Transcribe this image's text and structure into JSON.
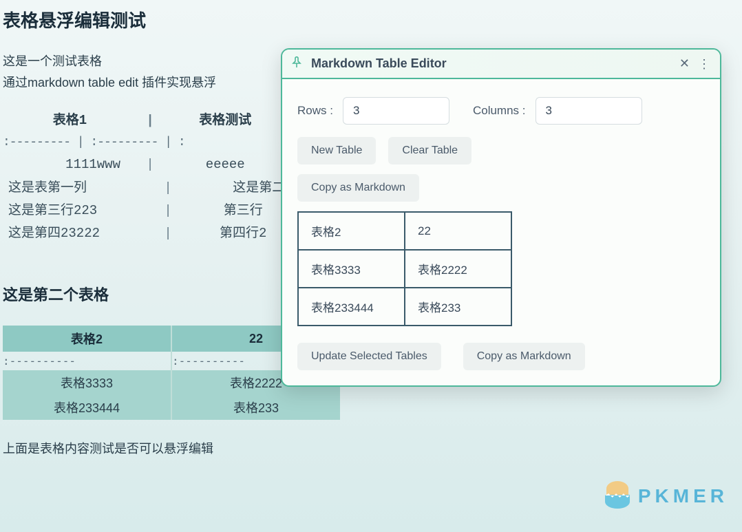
{
  "doc": {
    "title": "表格悬浮编辑测试",
    "para1": "这是一个测试表格",
    "para2": "通过markdown table edit 插件实现悬浮",
    "subtitle": "这是第二个表格",
    "footer": "上面是表格内容测试是否可以悬浮编辑"
  },
  "raw_table": {
    "headers": [
      "表格1",
      "表格测试"
    ],
    "separator": ":--------- | :--------- | :",
    "rows": [
      [
        "1111www",
        "eeeee"
      ],
      [
        "这是表第一列",
        "这是第二列"
      ],
      [
        "这是第三行223",
        "第三行"
      ],
      [
        "这是第四23222",
        "第四行2"
      ]
    ]
  },
  "hl_table": {
    "headers": [
      "表格2",
      "22"
    ],
    "separator_left": ":----------",
    "separator_right": ":----------",
    "rows": [
      [
        "表格3333",
        "表格2222"
      ],
      [
        "表格233444",
        "表格233"
      ]
    ]
  },
  "panel": {
    "title": "Markdown Table Editor",
    "rows_label": "Rows :",
    "rows_value": "3",
    "cols_label": "Columns :",
    "cols_value": "3",
    "btn_new": "New Table",
    "btn_clear": "Clear Table",
    "btn_copy": "Copy as Markdown",
    "btn_update": "Update Selected Tables",
    "btn_copy2": "Copy as Markdown",
    "editor_rows": [
      [
        "表格2",
        "22"
      ],
      [
        "表格3333",
        "表格2222"
      ],
      [
        "表格233444",
        "表格233"
      ]
    ]
  },
  "watermark": {
    "text": "PKMER"
  }
}
